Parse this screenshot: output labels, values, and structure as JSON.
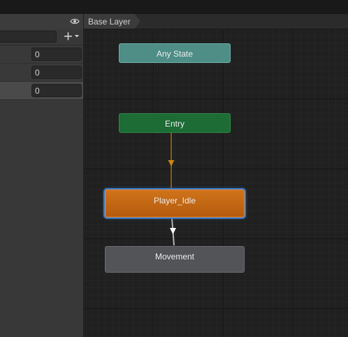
{
  "left_panel": {
    "search": {
      "value": "",
      "placeholder": ""
    },
    "add_button_icon": "plus-dropdown-icon",
    "eye_icon": "eye-icon",
    "parameters": [
      {
        "value": "0",
        "selected": false
      },
      {
        "value": "0",
        "selected": false
      },
      {
        "value": "0",
        "selected": true
      }
    ]
  },
  "graph": {
    "breadcrumb": "Base Layer",
    "nodes": {
      "any_state": "Any State",
      "entry": "Entry",
      "player_idle": "Player_Idle",
      "movement": "Movement"
    },
    "colors": {
      "any_state": "#4e8e87",
      "entry": "#1d6b35",
      "default_state": "#c86816",
      "state": "#525457",
      "selection": "#3a78c8",
      "entry_transition": "#8a5a10",
      "state_transition": "#b0b0b0"
    }
  }
}
